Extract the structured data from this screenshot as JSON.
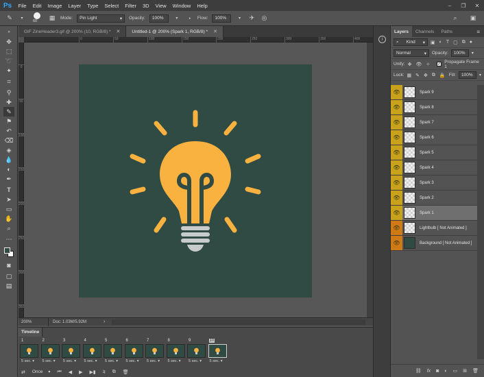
{
  "app": {
    "logo": "Ps"
  },
  "menu": [
    "File",
    "Edit",
    "Image",
    "Layer",
    "Type",
    "Select",
    "Filter",
    "3D",
    "View",
    "Window",
    "Help"
  ],
  "window_controls": [
    "–",
    "❐",
    "✕"
  ],
  "options_bar": {
    "brush_size": "60",
    "mode_label": "Mode:",
    "mode_value": "Pin Light",
    "opacity_label": "Opacity:",
    "opacity_value": "100%",
    "flow_label": "Flow:",
    "flow_value": "100%"
  },
  "doc_tabs": [
    {
      "label": "GIF ZineHeader3.gif @ 200% (10, RGB/8) *",
      "active": false
    },
    {
      "label": "Untitled-1 @ 200% (Spark 1, RGB/8) *",
      "active": true
    }
  ],
  "rulers": {
    "top": [
      "0",
      "50",
      "100",
      "150",
      "200",
      "250",
      "300",
      "350",
      "400",
      "450"
    ],
    "left": [
      "0",
      "50",
      "100",
      "150",
      "200",
      "250",
      "300",
      "350"
    ]
  },
  "status": {
    "zoom": "200%",
    "doc": "Doc: 1.03M/5.92M"
  },
  "timeline": {
    "title": "Timeline",
    "frames": [
      {
        "num": "1",
        "delay": "5 sec."
      },
      {
        "num": "2",
        "delay": "5 sec."
      },
      {
        "num": "3",
        "delay": "5 sec."
      },
      {
        "num": "4",
        "delay": "5 sec."
      },
      {
        "num": "5",
        "delay": "5 sec."
      },
      {
        "num": "6",
        "delay": "5 sec."
      },
      {
        "num": "7",
        "delay": "5 sec."
      },
      {
        "num": "8",
        "delay": "5 sec."
      },
      {
        "num": "9",
        "delay": "5 sec."
      },
      {
        "num": "10",
        "delay": "5 sec."
      }
    ],
    "selected_frame": "10",
    "loop": "Once"
  },
  "panel": {
    "tabs": [
      "Layers",
      "Channels",
      "Paths"
    ],
    "active_tab": "Layers",
    "filter_kind": "Kind",
    "blend_mode": "Normal",
    "opacity_label": "Opacity:",
    "opacity_value": "100%",
    "unify_label": "Unify:",
    "propagate_label": "Propagate Frame 1",
    "lock_label": "Lock:",
    "fill_label": "Fill:",
    "fill_value": "100%"
  },
  "layers": [
    {
      "name": "Spark 9",
      "eye": "orange-yellow",
      "thumb": "transparent",
      "selected": false
    },
    {
      "name": "Spark 8",
      "eye": "orange-yellow",
      "thumb": "transparent",
      "selected": false
    },
    {
      "name": "Spark 7",
      "eye": "orange-yellow",
      "thumb": "transparent",
      "selected": false
    },
    {
      "name": "Spark 6",
      "eye": "orange-yellow",
      "thumb": "transparent",
      "selected": false
    },
    {
      "name": "Spark 5",
      "eye": "orange-yellow",
      "thumb": "transparent",
      "selected": false
    },
    {
      "name": "Spark 4",
      "eye": "orange-yellow",
      "thumb": "transparent",
      "selected": false
    },
    {
      "name": "Spark 3",
      "eye": "orange-yellow",
      "thumb": "transparent",
      "selected": false
    },
    {
      "name": "Spark 2",
      "eye": "orange-yellow",
      "thumb": "transparent",
      "selected": false
    },
    {
      "name": "Spark 1",
      "eye": "orange-yellow",
      "thumb": "transparent",
      "selected": true
    },
    {
      "name": "Lightbulb [ Not Animated ]",
      "eye": "orange",
      "thumb": "transparent",
      "selected": false
    },
    {
      "name": "Background [ Not Animated ]",
      "eye": "orange",
      "thumb": "dark",
      "selected": false
    }
  ],
  "colors": {
    "artwork_bg": "#2f4b44",
    "bulb": "#f9b13f",
    "bulb_base": "#c7cbcb",
    "eye_yellow": "#c7a21a",
    "eye_orange": "#d07a16"
  }
}
